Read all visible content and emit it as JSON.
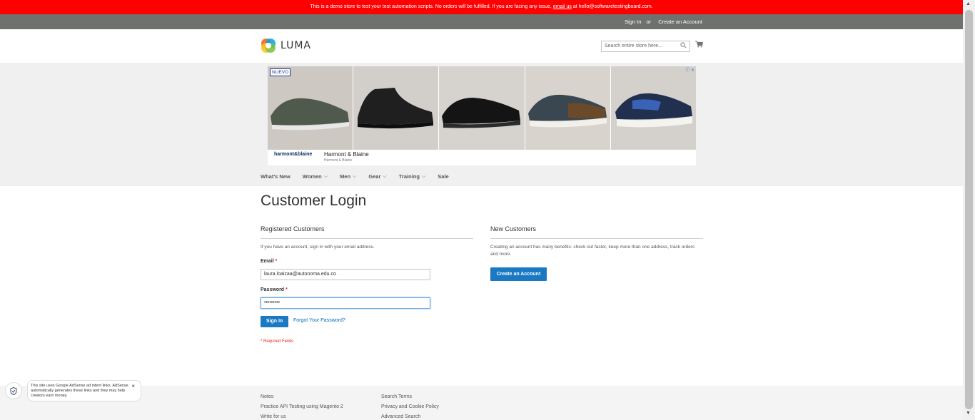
{
  "demo_banner": {
    "text_before": "This is a demo store to test your test automation scripts. No orders will be fulfilled. If you are facing any issue,",
    "link": "email us",
    "text_after": "at hello@softwaretestingboard.com."
  },
  "panel": {
    "sign_in": "Sign In",
    "or": "or",
    "create_account": "Create an Account"
  },
  "header": {
    "logo_text": "LUMA",
    "search_placeholder": "Search entire store here...",
    "icons": [
      "search-icon",
      "cart-icon"
    ]
  },
  "ad": {
    "badge": "NUEVO",
    "brand_logo": "harmont&blaine",
    "title": "Harmont & Blaine",
    "subtitle": "Harmont & Blaine",
    "product_count": 5
  },
  "nav": {
    "items": [
      {
        "label": "What's New",
        "has_menu": false
      },
      {
        "label": "Women",
        "has_menu": true
      },
      {
        "label": "Men",
        "has_menu": true
      },
      {
        "label": "Gear",
        "has_menu": true
      },
      {
        "label": "Training",
        "has_menu": true
      },
      {
        "label": "Sale",
        "has_menu": false
      }
    ]
  },
  "main": {
    "title": "Customer Login",
    "registered": {
      "title": "Registered Customers",
      "note": "If you have an account, sign in with your email address.",
      "email_label": "Email",
      "email_value": "laura.loaizaa@autonoma.edu.co",
      "password_label": "Password",
      "password_value": "•••••••••",
      "required_mark": "*",
      "sign_in_button": "Sign In",
      "forgot_link": "Forgot Your Password?",
      "required_note": "* Required Fields"
    },
    "new_customers": {
      "title": "New Customers",
      "note": "Creating an account has many benefits: check out faster, keep more than one address, track orders and more.",
      "create_button": "Create an Account"
    }
  },
  "footer": {
    "col1": [
      "Notes",
      "Practice API Testing using Magento 2",
      "Write for us"
    ],
    "col2": [
      "Search Terms",
      "Privacy and Cookie Policy",
      "Advanced Search"
    ]
  },
  "adsense_notice": {
    "text": "This site uses Google AdSense ad intent links. AdSense automatically generates these links and they may help creators earn money.",
    "close": "×"
  },
  "colors": {
    "demo_bar": "#ff0000",
    "panel": "#6e716e",
    "primary": "#1979c3",
    "link": "#006bb4",
    "required": "#e02b27"
  }
}
